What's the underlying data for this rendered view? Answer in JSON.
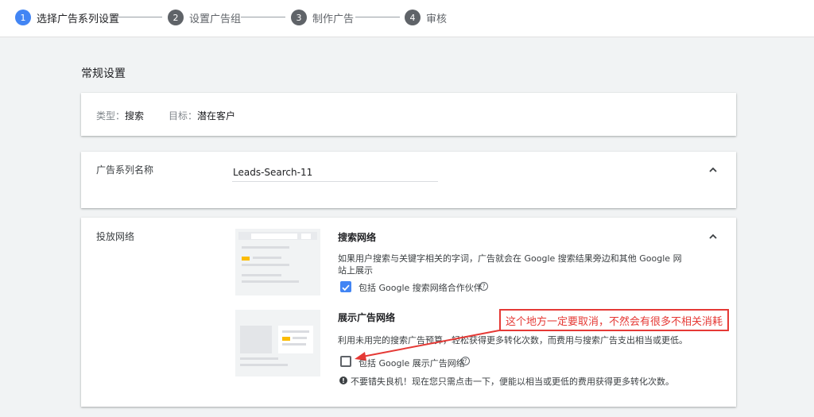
{
  "stepper": {
    "steps": [
      {
        "number": "1",
        "label": "选择广告系列设置",
        "active": true
      },
      {
        "number": "2",
        "label": "设置广告组"
      },
      {
        "number": "3",
        "label": "制作广告"
      },
      {
        "number": "4",
        "label": "审核"
      }
    ]
  },
  "section_title": "常规设置",
  "summary": {
    "type_key": "类型：",
    "type_value": "搜索",
    "goal_key": "目标：",
    "goal_value": "潜在客户"
  },
  "campaign_name": {
    "label": "广告系列名称",
    "value": "Leads-Search-11"
  },
  "networks": {
    "label": "投放网络",
    "search": {
      "title": "搜索网络",
      "description": "如果用户搜索与关键字相关的字词，广告就会在 Google 搜索结果旁边和其他 Google 网站上展示",
      "checkbox_label": "包括 Google 搜索网络合作伙伴",
      "checked": true
    },
    "display": {
      "title": "展示广告网络",
      "description": "利用未用完的搜索广告预算，轻松获得更多转化次数，而费用与搜索广告支出相当或更低。",
      "checkbox_label": "包括 Google 展示广告网络",
      "checked": false,
      "note": "不要错失良机！现在您只需点击一下，便能以相当或更低的费用获得更多转化次数。"
    }
  },
  "annotation": {
    "text": "这个地方一定要取消，不然会有很多不相关消耗",
    "color": "#e53935"
  },
  "colors": {
    "accent": "#4285f4",
    "illustration_highlight": "#fbbc04"
  }
}
